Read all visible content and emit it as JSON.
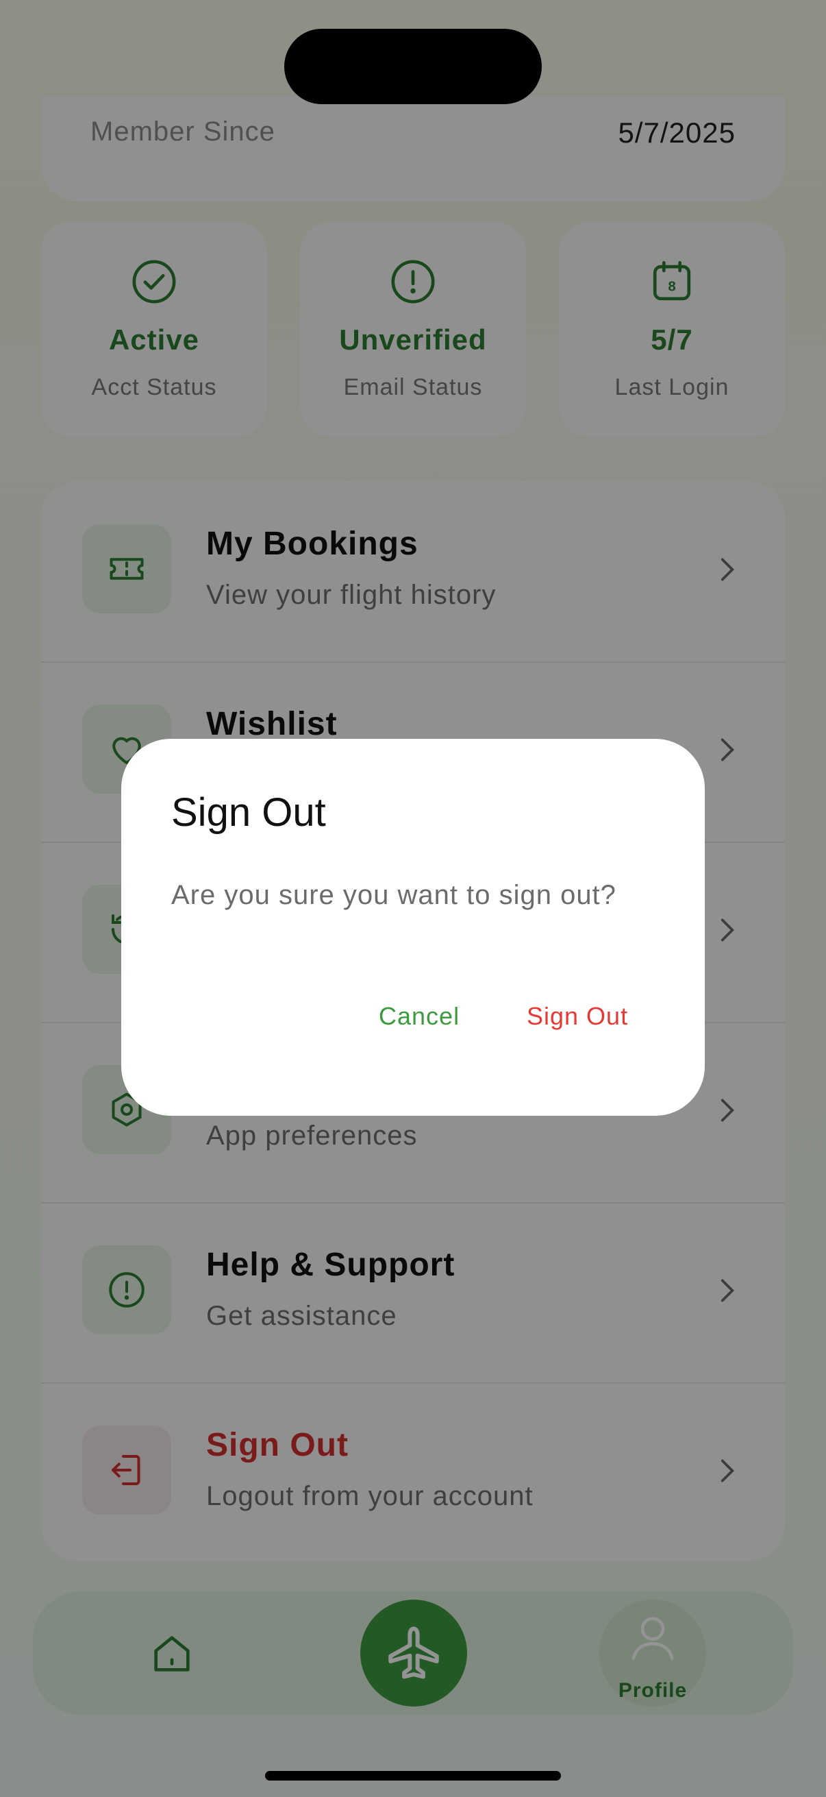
{
  "profile": {
    "member_since_label": "Member Since",
    "member_since_value": "5/7/2025"
  },
  "stats": [
    {
      "icon": "check-circle-icon",
      "value": "Active",
      "label": "Acct Status"
    },
    {
      "icon": "alert-circle-icon",
      "value": "Unverified",
      "label": "Email Status"
    },
    {
      "icon": "calendar-icon",
      "icon_text": "8",
      "value": "5/7",
      "label": "Last Login"
    }
  ],
  "menu": [
    {
      "icon": "ticket-icon",
      "title": "My Bookings",
      "subtitle": "View your flight history"
    },
    {
      "icon": "heart-icon",
      "title": "Wishlist",
      "subtitle": ""
    },
    {
      "icon": "history-icon",
      "title": "",
      "subtitle": ""
    },
    {
      "icon": "settings-icon",
      "title": "",
      "subtitle": "App preferences"
    },
    {
      "icon": "help-icon",
      "title": "Help & Support",
      "subtitle": "Get assistance"
    },
    {
      "icon": "sign-out-icon",
      "title": "Sign Out",
      "subtitle": "Logout from your account"
    }
  ],
  "nav": {
    "profile_label": "Profile"
  },
  "dialog": {
    "title": "Sign Out",
    "message": "Are you sure you want to sign out?",
    "cancel_label": "Cancel",
    "confirm_label": "Sign Out"
  },
  "colors": {
    "accent": "#2e7d32",
    "danger": "#d32f2f",
    "fab": "#3c9a3f"
  }
}
